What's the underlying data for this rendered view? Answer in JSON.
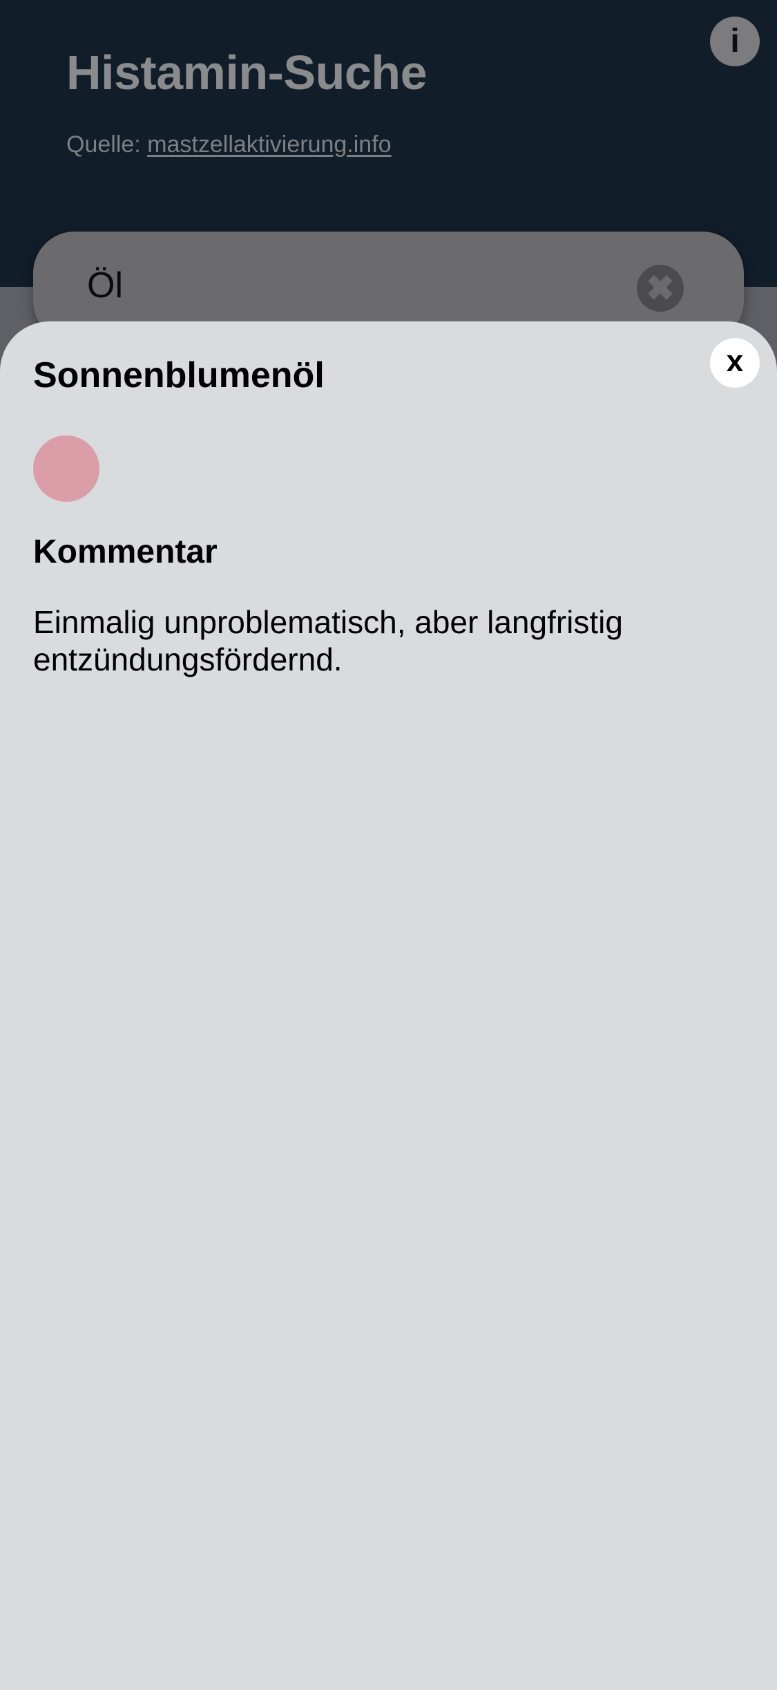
{
  "header": {
    "title": "Histamin-Suche",
    "source_prefix": "Quelle: ",
    "source_link": "mastzellaktivierung.info",
    "info_label": "i"
  },
  "search": {
    "value": "Öl",
    "clear_icon": "close-circle-icon",
    "clear_glyph": "✖"
  },
  "detail": {
    "title": "Sonnenblumenöl",
    "close_label": "x",
    "rating_color": "#db9ea8",
    "comment_heading": "Kommentar",
    "comment_text": "Einmalig unproblematisch, aber langfristig entzündungsfördernd."
  },
  "colors": {
    "header_bg": "#111d29",
    "sheet_bg": "#d9dcdf",
    "search_bg": "#6b6b6d"
  }
}
